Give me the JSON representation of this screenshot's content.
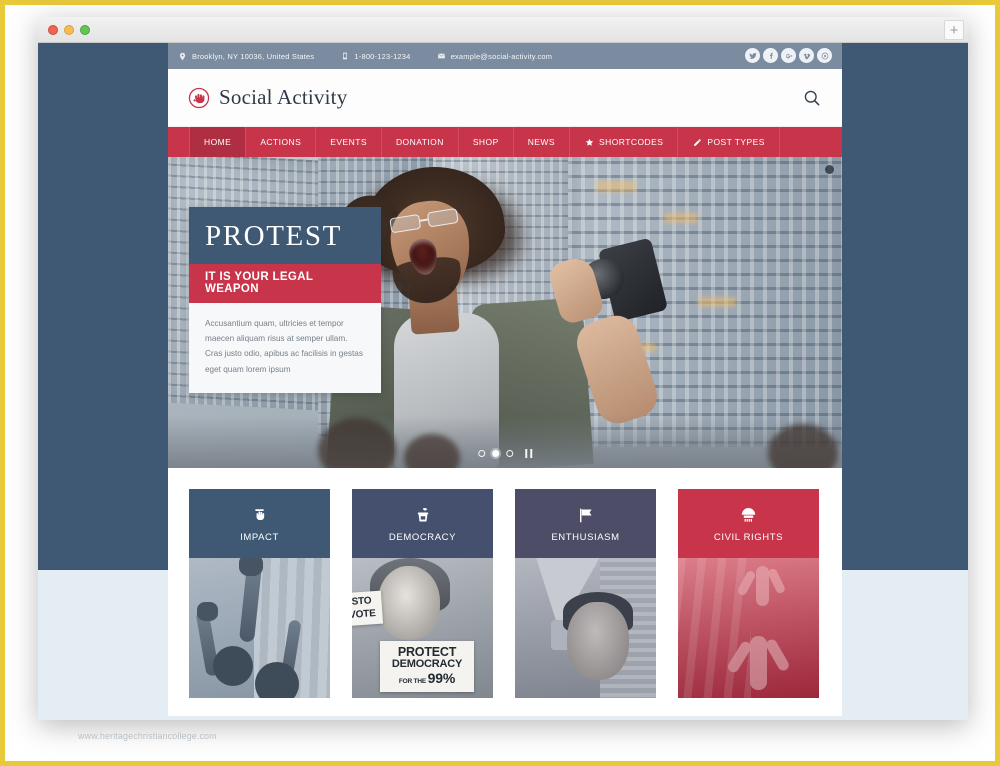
{
  "browser": {
    "new_tab_label": "+",
    "traffic_lights": [
      "close-red",
      "minimize-yellow",
      "maximize-green"
    ]
  },
  "watermark": "www.heritagechristiancollege.com",
  "topbar": {
    "address": "Brooklyn, NY 10036, United States",
    "phone": "1-800-123-1234",
    "email": "example@social-activity.com",
    "icons": {
      "location": "location-pin-icon",
      "phone": "mobile-phone-icon",
      "email": "envelope-icon"
    },
    "socials": [
      {
        "name": "twitter",
        "glyph": "✒"
      },
      {
        "name": "facebook",
        "glyph": "f"
      },
      {
        "name": "google-plus",
        "glyph": "g"
      },
      {
        "name": "vimeo",
        "glyph": "v"
      },
      {
        "name": "dribbble",
        "glyph": "◎"
      }
    ]
  },
  "header": {
    "brand": "Social Activity",
    "logo_icon": "raised-fist-icon",
    "search_icon": "search-icon"
  },
  "nav": {
    "items": [
      {
        "label": "HOME",
        "active": true,
        "icon": ""
      },
      {
        "label": "ACTIONS",
        "active": false,
        "icon": ""
      },
      {
        "label": "EVENTS",
        "active": false,
        "icon": ""
      },
      {
        "label": "DONATION",
        "active": false,
        "icon": ""
      },
      {
        "label": "SHOP",
        "active": false,
        "icon": ""
      },
      {
        "label": "NEWS",
        "active": false,
        "icon": ""
      },
      {
        "label": "SHORTCODES",
        "active": false,
        "icon": "star-icon"
      },
      {
        "label": "POST TYPES",
        "active": false,
        "icon": "pencil-icon"
      }
    ]
  },
  "hero": {
    "title": "PROTEST",
    "subtitle": "IT IS YOUR LEGAL WEAPON",
    "body": "Accusantium quam, ultricies et tempor maecen aliquam risus at semper ullam. Cras justo odio, apibus ac facilisis in gestas eget quam lorem ipsum",
    "slide_count": 3,
    "active_slide": 2,
    "pause_label": "pause",
    "image_alt": "Protester shouting with raised fist in front of glass office buildings"
  },
  "cards": [
    {
      "label": "IMPACT",
      "icon": "raised-fist-icon",
      "bg": "#3f5874",
      "image_alt": "Crowd with raised fists"
    },
    {
      "label": "DEMOCRACY",
      "icon": "podium-speaker-icon",
      "bg": "#44506e",
      "image_alt": "Protester holding PROTECT DEMOCRACY FOR THE 99% sign"
    },
    {
      "label": "ENTHUSIASM",
      "icon": "flag-icon",
      "bg": "#4d4d68",
      "image_alt": "Protester shouting into a megaphone"
    },
    {
      "label": "CIVIL RIGHTS",
      "icon": "vote-badge-icon",
      "bg": "#c8354a",
      "image_alt": "Statue of figures with raised arms"
    }
  ],
  "card_images": {
    "democracy": {
      "sign_line1": "PROTECT",
      "sign_line2": "DEMOCRACY",
      "sign_line3_pre": "FOR THE",
      "sign_line3_num": "99%",
      "side_sign_l1": "STO",
      "side_sign_l2": "VOTE"
    }
  },
  "colors": {
    "accent_red": "#c8354a",
    "dark_slate": "#3f5874",
    "topbar_grey": "#7c8ca0",
    "page_bg_light": "#e4edf4",
    "frame_gold": "#e8c93a"
  }
}
